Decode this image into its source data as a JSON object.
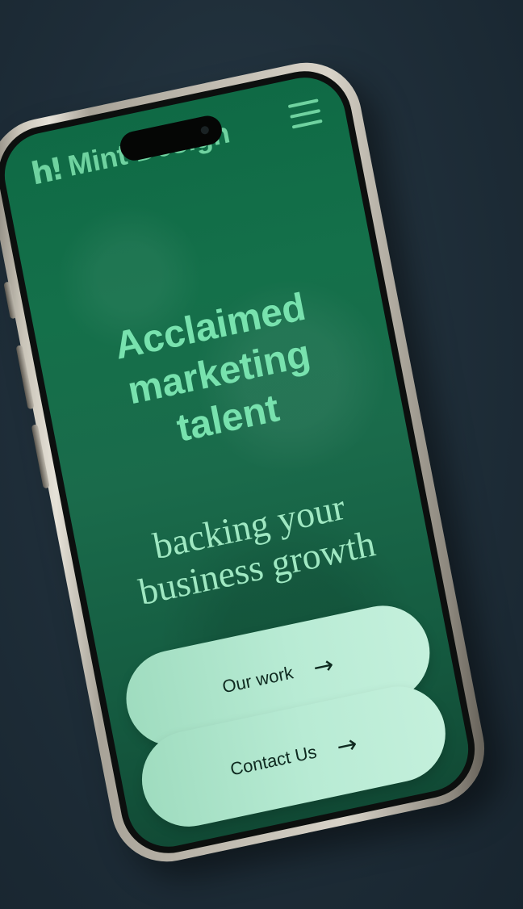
{
  "brand": {
    "logo_mark": "h!",
    "name": "Mint Design"
  },
  "nav": {
    "menu_icon": "hamburger-menu-icon"
  },
  "hero": {
    "headline_lines": [
      "Acclaimed",
      "marketing",
      "talent"
    ],
    "subheadline_lines": [
      "backing your",
      "business growth"
    ]
  },
  "actions": {
    "our_work_label": "Our work",
    "contact_label": "Contact Us",
    "arrow_icon": "arrow-right-icon",
    "arrow_glyph": "→"
  },
  "colors": {
    "background": "#1f2f3a",
    "screen_green": "#14704a",
    "accent_mint": "#78e2ae",
    "button_fill": "#b8ebd4",
    "button_text": "#0f2a20"
  }
}
